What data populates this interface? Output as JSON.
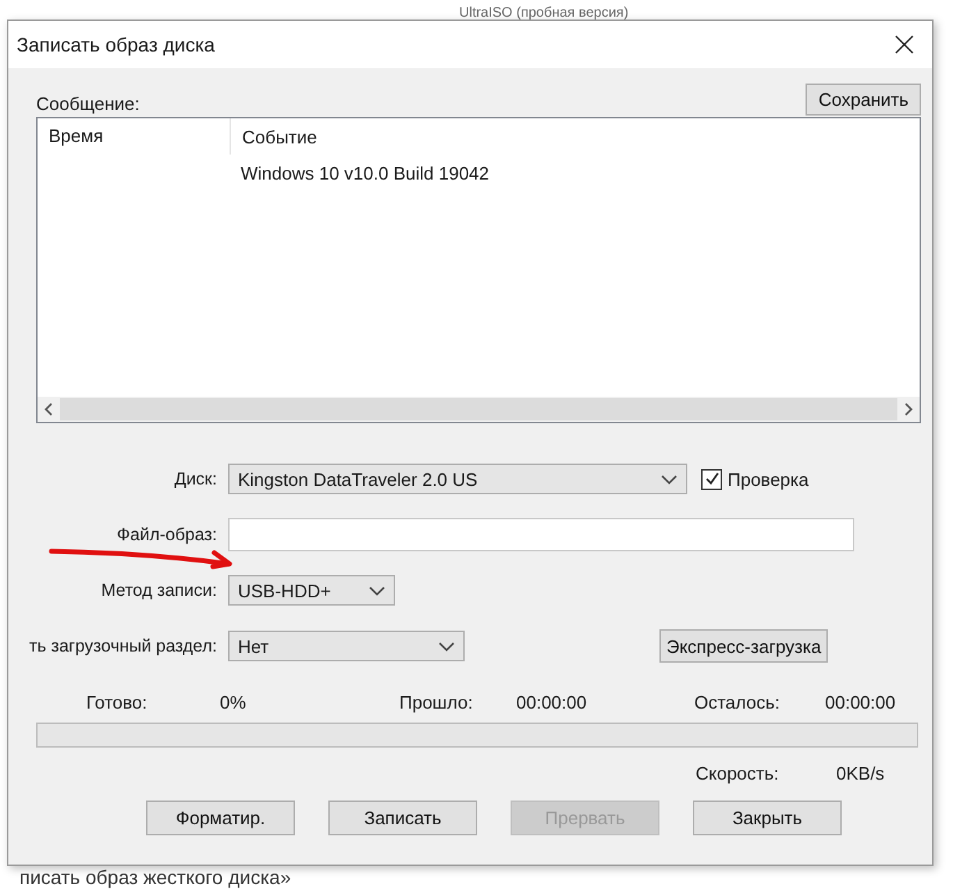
{
  "background": {
    "top_text": "UltraISO (пробная версия)",
    "bottom_text": "писать образ жесткого диска»"
  },
  "window": {
    "title": "Записать образ диска"
  },
  "message": {
    "label": "Сообщение:",
    "save_button": "Сохранить",
    "columns": [
      "Время",
      "Событие"
    ],
    "rows": [
      {
        "event": "Windows 10 v10.0 Build 19042"
      }
    ]
  },
  "fields": [
    {
      "kind": "combo",
      "label": "Диск:",
      "value": "Kingston DataTraveler 2.0 US",
      "checkbox": {
        "label": "Проверка",
        "checked": true
      }
    },
    {
      "kind": "text",
      "label": "Файл-образ:"
    },
    {
      "kind": "combo",
      "label": "Метод записи:",
      "value": "USB-HDD+"
    },
    {
      "kind": "combo",
      "label": "ть загрузочный раздел:",
      "value": "Нет",
      "button": "Экспресс-загрузка"
    }
  ],
  "progress": {
    "done_label": "Готово:",
    "done": "0%",
    "elapsed_label": "Прошло:",
    "elapsed": "00:00:00",
    "remaining_label": "Осталось:",
    "remaining": "00:00:00",
    "level": 0,
    "speed_label": "Скорость:",
    "speed": "0KB/s"
  },
  "buttons": [
    {
      "label": "Форматир.",
      "disabled": false
    },
    {
      "label": "Записать",
      "disabled": false
    },
    {
      "label": "Прервать",
      "disabled": true
    },
    {
      "label": "Закрыть",
      "disabled": false
    }
  ]
}
